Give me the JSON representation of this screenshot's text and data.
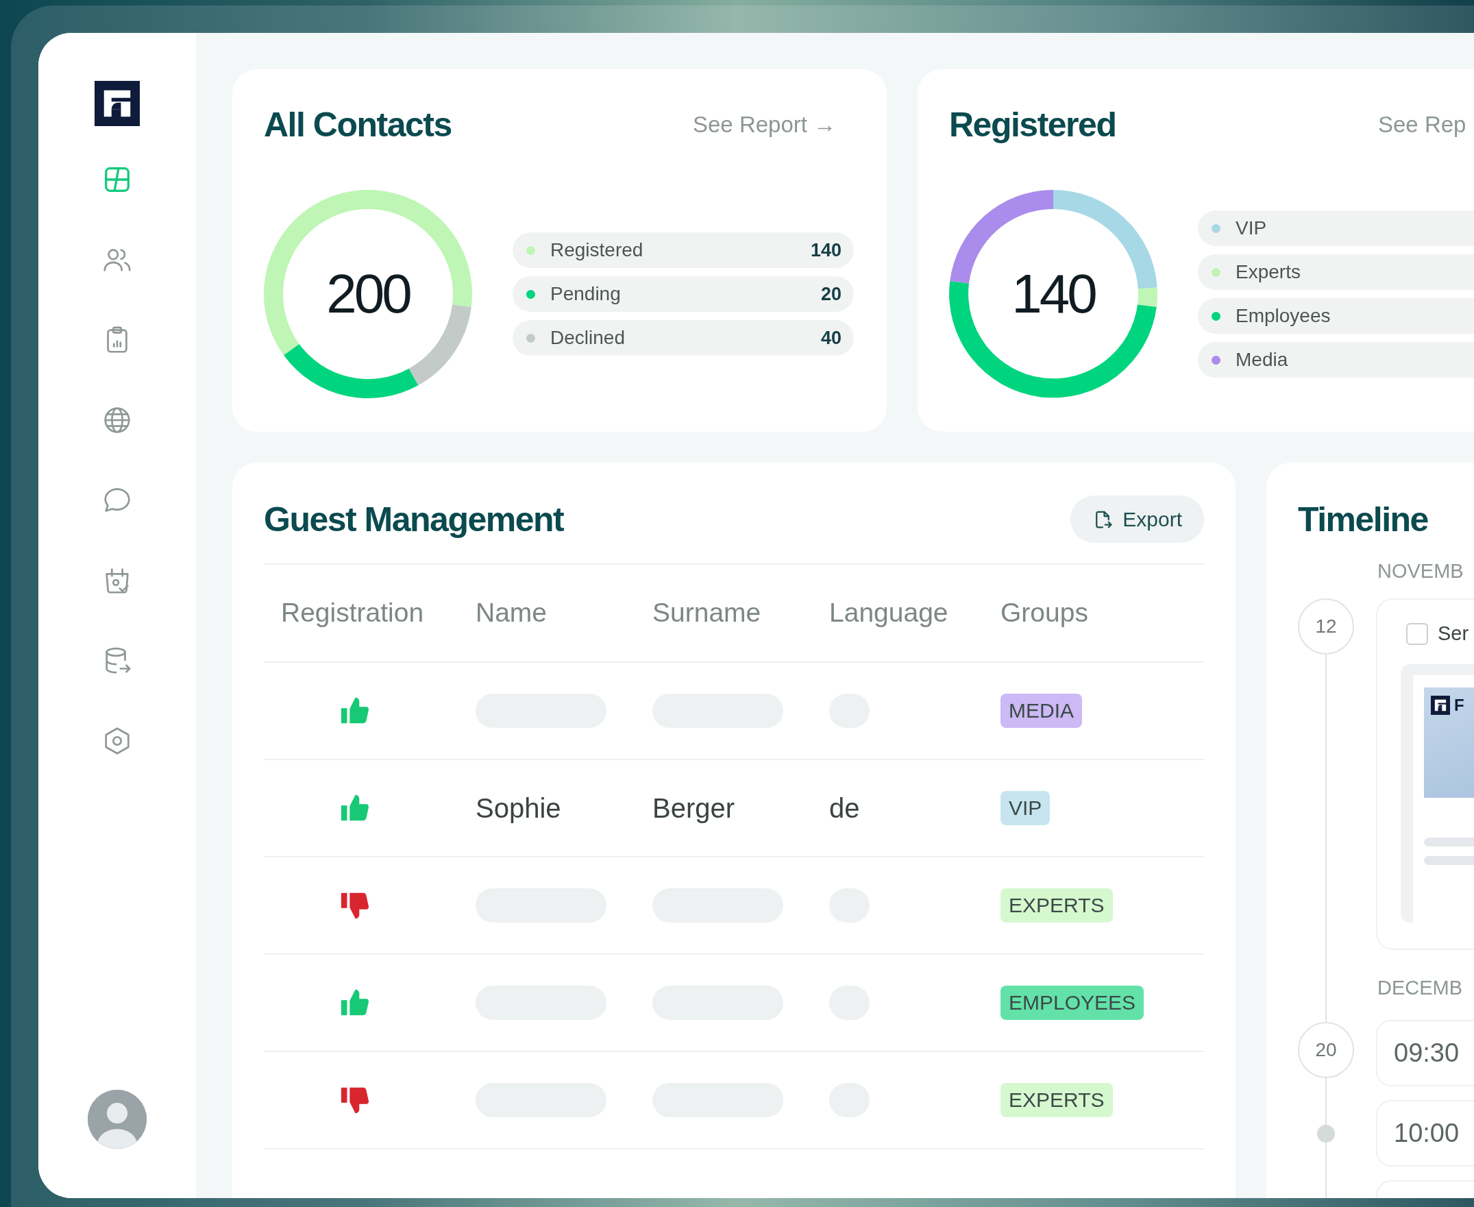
{
  "sidebar": {
    "items": [
      {
        "selected": true
      },
      {
        "selected": false
      },
      {
        "selected": false
      },
      {
        "selected": false
      },
      {
        "selected": false
      },
      {
        "selected": false
      },
      {
        "selected": false
      },
      {
        "selected": false
      }
    ]
  },
  "cards": [
    {
      "title": "All Contacts",
      "link": "See Report →",
      "total": "200",
      "legend": [
        {
          "label": "Registered",
          "value": "140",
          "color": "#bff5b5"
        },
        {
          "label": "Pending",
          "value": "20",
          "color": "#00d47e"
        },
        {
          "label": "Declined",
          "value": "40",
          "color": "#c3cbc9"
        }
      ]
    },
    {
      "title": "Registered",
      "link": "See Rep",
      "total": "140",
      "legend": [
        {
          "label": "VIP",
          "color": "#a6d8e6"
        },
        {
          "label": "Experts",
          "color": "#bff5b5"
        },
        {
          "label": "Employees",
          "color": "#00d47e"
        },
        {
          "label": "Media",
          "color": "#a98cec"
        }
      ]
    }
  ],
  "guest": {
    "title": "Guest Management",
    "export": "Export",
    "columns": [
      "Registration",
      "Name",
      "Surname",
      "Language",
      "Groups"
    ],
    "rows": [
      {
        "registered": true,
        "redacted": true,
        "group": {
          "label": "MEDIA",
          "color": "#cdb9f5"
        }
      },
      {
        "registered": true,
        "redacted": false,
        "name": "Sophie",
        "surname": "Berger",
        "language": "de",
        "group": {
          "label": "VIP",
          "color": "#c6e5ee"
        }
      },
      {
        "registered": false,
        "redacted": true,
        "group": {
          "label": "EXPERTS",
          "color": "#d6f8cf"
        }
      },
      {
        "registered": true,
        "redacted": true,
        "group": {
          "label": "EMPLOYEES",
          "color": "#62e2a8"
        }
      },
      {
        "registered": false,
        "redacted": true,
        "group": {
          "label": "EXPERTS",
          "color": "#d6f8cf"
        }
      }
    ]
  },
  "timeline": {
    "title": "Timeline",
    "sections": [
      {
        "month": "NOVEMB",
        "day": "12",
        "events": [
          {
            "kind": "task",
            "title": "Ser",
            "checked": false,
            "preview_text": "F"
          }
        ]
      },
      {
        "month": "DECEMB",
        "day": "20",
        "events": [
          {
            "kind": "time",
            "time": "09:30"
          },
          {
            "kind": "time",
            "time": "10:00"
          },
          {
            "kind": "blank"
          }
        ]
      }
    ]
  }
}
